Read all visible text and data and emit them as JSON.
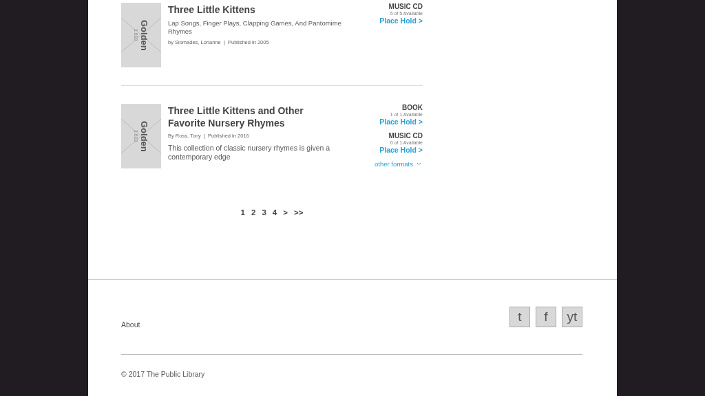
{
  "results": [
    {
      "cover": {
        "title": "Golden",
        "ratio": "1.618"
      },
      "title": "Three Little Kittens",
      "subtitle": "Lap Songs, Finger Plays, Clapping Games, And Pantomime Rhymes",
      "meta": "by Siomades, Lorianne  |  Published in 2005",
      "formats": [
        {
          "format": "MUSIC CD",
          "availability": "5 of 5 Available",
          "action": "Place Hold >"
        }
      ]
    },
    {
      "cover": {
        "title": "Golden",
        "ratio": "1.618"
      },
      "title": "Three Little Kittens and Other Favorite Nursery Rhymes",
      "meta": "By Ross, Tony  |  Published in 2016",
      "description": "This collection of classic nursery rhymes is given a contemporary edge",
      "formats": [
        {
          "format": "BOOK",
          "availability": "1 of 1 Available",
          "action": "Place Hold >"
        },
        {
          "format": "MUSIC CD",
          "availability": "0 of 1 Available",
          "action": "Place Hold >"
        }
      ],
      "more_formats": "other formats"
    }
  ],
  "pagination": [
    "1",
    "2",
    "3",
    "4",
    ">",
    ">>"
  ],
  "footer": {
    "links": [
      "About"
    ],
    "social": [
      "t",
      "f",
      "yt"
    ],
    "copyright": "© 2017 The Public Library"
  }
}
